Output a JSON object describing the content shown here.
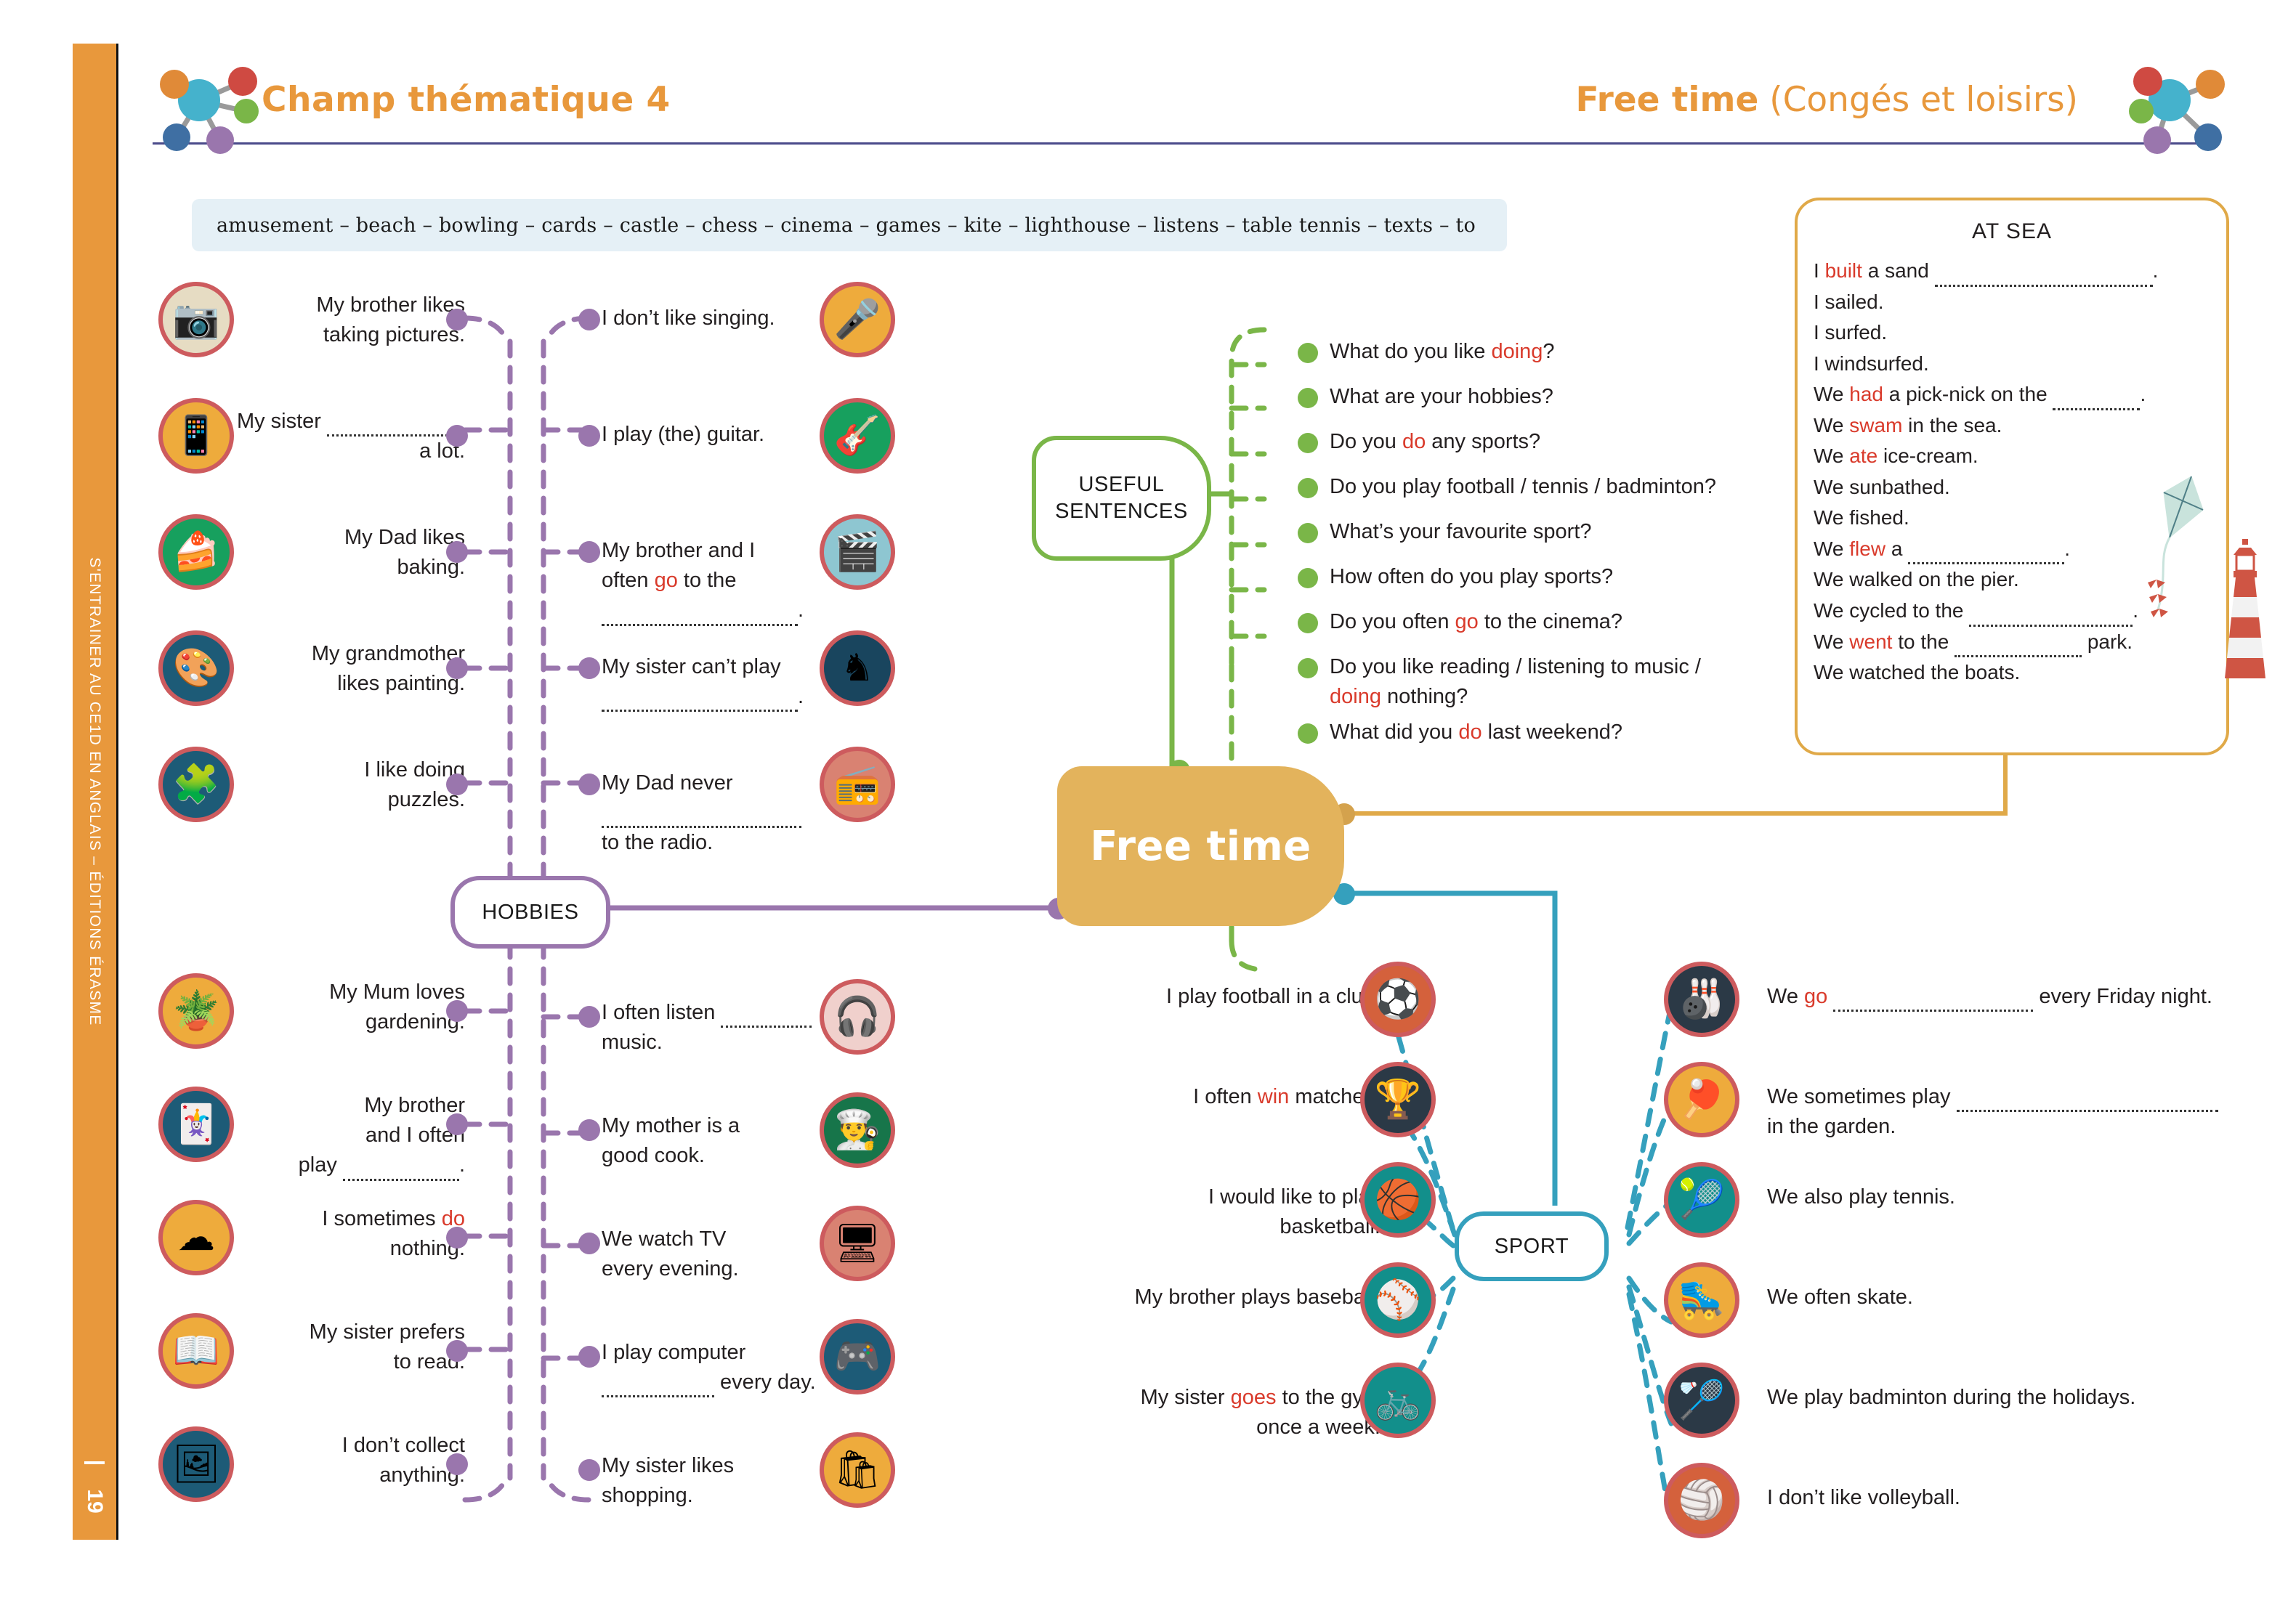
{
  "sidebar": {
    "text": "S'ENTRAINER AU CE1D EN ANGLAIS – ÉDITIONS ÉRASME",
    "page": "19"
  },
  "header": {
    "left_title": "Champ thématique 4",
    "right_title_bold": "Free time",
    "right_title_paren": " (Congés et loisirs)",
    "left_icon": "molecule-icon",
    "right_icon": "molecule-icon"
  },
  "wordbank": {
    "text": "amusement – beach – bowling – cards – castle – chess – cinema – games – kite – lighthouse – listens – table tennis – texts – to"
  },
  "center": {
    "label": "Free time"
  },
  "branches": {
    "hobbies_label": "HOBBIES",
    "sport_label": "SPORT",
    "useful_label_line1": "USEFUL",
    "useful_label_line2": "SENTENCES"
  },
  "colors": {
    "accent_orange": "#e8983c",
    "hobbies_purple": "#9a76ad",
    "sport_blue": "#35a0bd",
    "useful_green": "#7ab648",
    "center_gold": "#e3b35c",
    "red_highlight": "#d93a2b",
    "badge_ring_red": "#cd5b5e",
    "wordbank_bg": "#e5f0f6"
  },
  "hobbies_top_left": [
    {
      "icon": "camera-icon",
      "bg": "#e6dcc3",
      "text_html": "My brother likes<br>taking pictures."
    },
    {
      "icon": "tablet-icon",
      "bg": "#eeab3c",
      "text_html": "My sister <span class=\"fill\" style=\"width:190px\"></span><br>a lot."
    },
    {
      "icon": "cake-icon",
      "bg": "#17a05e",
      "text_html": "My Dad likes<br>baking."
    },
    {
      "icon": "palette-icon",
      "bg": "#1d5b77",
      "text_html": "My grandmother<br>likes painting."
    },
    {
      "icon": "puzzle-icon",
      "bg": "#1d5b77",
      "text_html": "I like doing<br>puzzles."
    }
  ],
  "hobbies_top_right": [
    {
      "icon": "microphone-icon",
      "bg": "#eeab3c",
      "text_html": "I don’t like singing."
    },
    {
      "icon": "guitar-icon",
      "bg": "#17a05e",
      "text_html": "I play (the) guitar."
    },
    {
      "icon": "clapperboard-icon",
      "bg": "#8ec6d1",
      "text_html": "My brother and I<br>often <span class=\"red\">go</span> to the<br><span class=\"fill\" style=\"width:270px\"></span>."
    },
    {
      "icon": "chess-knight-icon",
      "bg": "#19455e",
      "text_html": "My sister can’t play<br><span class=\"fill\" style=\"width:270px\"></span>."
    },
    {
      "icon": "radio-icon",
      "bg": "#d98272",
      "text_html": "My Dad never<br><span class=\"fill\" style=\"width:275px\"></span><br>to the radio."
    }
  ],
  "hobbies_bottom_left": [
    {
      "icon": "gardening-icon",
      "bg": "#eeab3c",
      "text_html": "My Mum loves<br>gardening."
    },
    {
      "icon": "playing-cards-icon",
      "bg": "#1d5b77",
      "text_html": "My brother<br>and I often<br>play <span class=\"fill\" style=\"width:160px\"></span>."
    },
    {
      "icon": "cloud-icon",
      "bg": "#eeab3c",
      "text_html": "I sometimes <span class=\"red\">do</span><br>nothing."
    },
    {
      "icon": "open-book-icon",
      "bg": "#eeab3c",
      "text_html": "My sister prefers<br>to read."
    },
    {
      "icon": "stamp-icon",
      "bg": "#1d5b77",
      "text_html": "I don’t collect<br>anything."
    }
  ],
  "hobbies_bottom_right": [
    {
      "icon": "headphones-icon",
      "bg": "#f0d0cc",
      "text_html": "I often listen <span class=\"fill\" style=\"width:125px\"></span><br>music."
    },
    {
      "icon": "chef-hat-icon",
      "bg": "#17754a",
      "text_html": "My mother is a<br>good cook."
    },
    {
      "icon": "tv-icon",
      "bg": "#d98272",
      "text_html": "We watch TV<br>every evening."
    },
    {
      "icon": "gamepad-icon",
      "bg": "#1d5b77",
      "text_html": "I play computer<br><span class=\"fill\" style=\"width:155px\"></span> every day."
    },
    {
      "icon": "shopping-bag-icon",
      "bg": "#eeab3c",
      "text_html": "My sister likes<br>shopping."
    }
  ],
  "useful_sentences": [
    "What do you like <span class=\"red\">doing</span>?",
    "What are your hobbies?",
    "Do you <span class=\"red\">do</span> any sports?",
    "Do you play football / tennis / badminton?",
    "What’s your favourite sport?",
    "How often do you play sports?",
    "Do you often <span class=\"red\">go</span> to the cinema?",
    "Do you like reading / listening to music /<br><span class=\"red\">doing</span> nothing?",
    "What did you <span class=\"red\">do</span> last weekend?"
  ],
  "at_sea": {
    "title": "AT SEA",
    "lines": [
      "I <span class=\"red\">built</span> a sand <span class=\"fill\" style=\"width:300px\"></span>.",
      "I sailed.",
      "I surfed.",
      "I windsurfed.",
      "We <span class=\"red\">had</span> a pick-nick on the <span class=\"fill\" style=\"width:120px\"></span>.",
      "We <span class=\"red\">swam</span> in the sea.",
      "We <span class=\"red\">ate</span> ice-cream.",
      "We sunbathed.",
      "We fished.",
      "We <span class=\"red\">flew</span> a <span class=\"fill\" style=\"width:215px\"></span>.",
      "We walked on the pier.",
      "We cycled to the <span class=\"fill\" style=\"width:225px\"></span>.",
      "We <span class=\"red\">went</span> to the <span class=\"fill\" style=\"width:175px\"></span> park.",
      "We watched the boats."
    ],
    "decor": [
      "kite-icon",
      "lighthouse-icon"
    ]
  },
  "sport_left": [
    {
      "icon": "football-icon",
      "bg": "#d4613c",
      "text_html": "I play football in a club."
    },
    {
      "icon": "trophy-icon",
      "bg": "#2b3946",
      "text_html": "I often <span class=\"red\">win</span> matches."
    },
    {
      "icon": "basketball-icon",
      "bg": "#128f8b",
      "text_html": "I would like to play<br>basketball."
    },
    {
      "icon": "baseball-icon",
      "bg": "#128f8b",
      "text_html": "My brother plays baseball."
    },
    {
      "icon": "exercise-bike-icon",
      "bg": "#128f8b",
      "text_html": "My sister <span class=\"red\">goes</span> to the gym<br>once a week."
    }
  ],
  "sport_right": [
    {
      "icon": "bowling-icon",
      "bg": "#2b3946",
      "text_html": "We <span class=\"red\">go</span> <span class=\"fill\" style=\"width:275px\"></span> every Friday night."
    },
    {
      "icon": "table-tennis-icon",
      "bg": "#eeab3c",
      "text_html": "We sometimes play <span class=\"fill\" style=\"width:360px\"></span><br>in the garden."
    },
    {
      "icon": "tennis-racket-icon",
      "bg": "#128f8b",
      "text_html": "We also play tennis."
    },
    {
      "icon": "roller-skate-icon",
      "bg": "#eeab3c",
      "text_html": "We often skate."
    },
    {
      "icon": "shuttlecock-icon",
      "bg": "#2b3946",
      "text_html": "We play badminton during the holidays."
    },
    {
      "icon": "volleyball-icon",
      "bg": "#d4613c",
      "text_html": "I don’t like volleyball."
    }
  ]
}
